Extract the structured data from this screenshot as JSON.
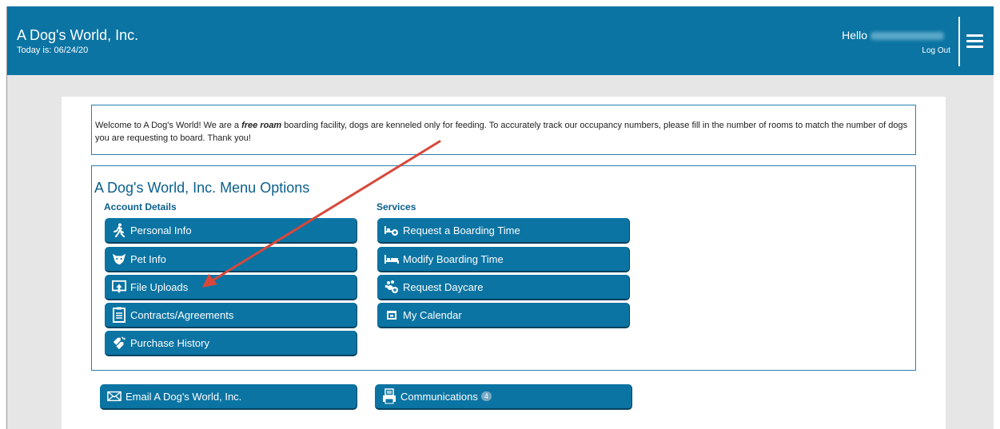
{
  "header": {
    "title": "A Dog's World, Inc.",
    "today": "Today is: 06/24/20",
    "greeting": "Hello",
    "logout": "Log Out"
  },
  "welcome": {
    "intro": "Welcome to A Dog's World! We are a ",
    "emphasis": "free roam",
    "rest": " boarding facility, dogs are kenneled only for feeding. To accurately track our occupancy numbers, please fill in the number of rooms to match the number of dogs you are requesting to board.  Thank you!"
  },
  "menu": {
    "title": "A Dog's World, Inc. Menu Options",
    "account_heading": "Account Details",
    "services_heading": "Services",
    "account_items": [
      {
        "label": "Personal Info",
        "icon": "walking-person-icon"
      },
      {
        "label": "Pet Info",
        "icon": "dog-face-icon"
      },
      {
        "label": "File Uploads",
        "icon": "upload-icon"
      },
      {
        "label": "Contracts/Agreements",
        "icon": "clipboard-icon"
      },
      {
        "label": "Purchase History",
        "icon": "price-tags-icon"
      }
    ],
    "service_items": [
      {
        "label": "Request a Boarding Time",
        "icon": "bed-plus-icon"
      },
      {
        "label": "Modify Boarding Time",
        "icon": "bed-icon"
      },
      {
        "label": "Request Daycare",
        "icon": "paw-icon"
      },
      {
        "label": "My Calendar",
        "icon": "calendar-icon"
      }
    ]
  },
  "footer": {
    "email_label": "Email A Dog's World, Inc.",
    "communications_label": "Communications",
    "communications_count": "4"
  },
  "colors": {
    "brand": "#0b74a3",
    "annotation_arrow": "#d8473a"
  }
}
